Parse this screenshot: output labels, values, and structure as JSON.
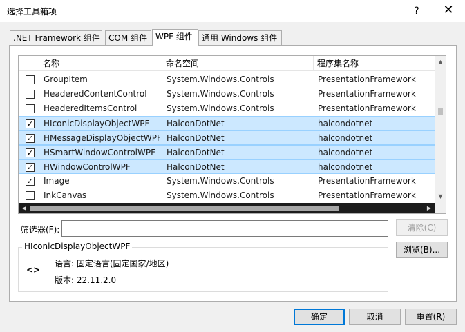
{
  "window": {
    "title": "选择工具箱项",
    "help_label": "?",
    "close_label": "✕"
  },
  "tabs": [
    {
      "label": ".NET Framework 组件"
    },
    {
      "label": "COM 组件"
    },
    {
      "label": "WPF 组件"
    },
    {
      "label": "通用 Windows 组件"
    }
  ],
  "grid": {
    "columns": [
      "名称",
      "命名空间",
      "程序集名称"
    ],
    "rows": [
      {
        "checked": false,
        "selected": false,
        "name": "GroupItem",
        "namespace": "System.Windows.Controls",
        "assembly": "PresentationFramework"
      },
      {
        "checked": false,
        "selected": false,
        "name": "HeaderedContentControl",
        "namespace": "System.Windows.Controls",
        "assembly": "PresentationFramework"
      },
      {
        "checked": false,
        "selected": false,
        "name": "HeaderedItemsControl",
        "namespace": "System.Windows.Controls",
        "assembly": "PresentationFramework"
      },
      {
        "checked": true,
        "selected": true,
        "name": "HIconicDisplayObjectWPF",
        "namespace": "HalconDotNet",
        "assembly": "halcondotnet"
      },
      {
        "checked": true,
        "selected": true,
        "name": "HMessageDisplayObjectWPF",
        "namespace": "HalconDotNet",
        "assembly": "halcondotnet"
      },
      {
        "checked": true,
        "selected": true,
        "name": "HSmartWindowControlWPF",
        "namespace": "HalconDotNet",
        "assembly": "halcondotnet"
      },
      {
        "checked": true,
        "selected": true,
        "name": "HWindowControlWPF",
        "namespace": "HalconDotNet",
        "assembly": "halcondotnet"
      },
      {
        "checked": true,
        "selected": false,
        "name": "Image",
        "namespace": "System.Windows.Controls",
        "assembly": "PresentationFramework"
      },
      {
        "checked": false,
        "selected": false,
        "name": "InkCanvas",
        "namespace": "System.Windows.Controls",
        "assembly": "PresentationFramework"
      }
    ]
  },
  "filter": {
    "label": "筛选器(F):",
    "value": "",
    "clear_label": "清除(C)"
  },
  "details": {
    "title": "HIconicDisplayObjectWPF",
    "icon": "<>",
    "language": "语言: 固定语言(固定国家/地区)",
    "version": "版本: 22.11.2.0",
    "browse_label": "浏览(B)..."
  },
  "footer": {
    "ok_label": "确定",
    "cancel_label": "取消",
    "reset_label": "重置(R)"
  },
  "colors": {
    "selected_row": "#cce8ff",
    "accent": "#0078d7"
  }
}
